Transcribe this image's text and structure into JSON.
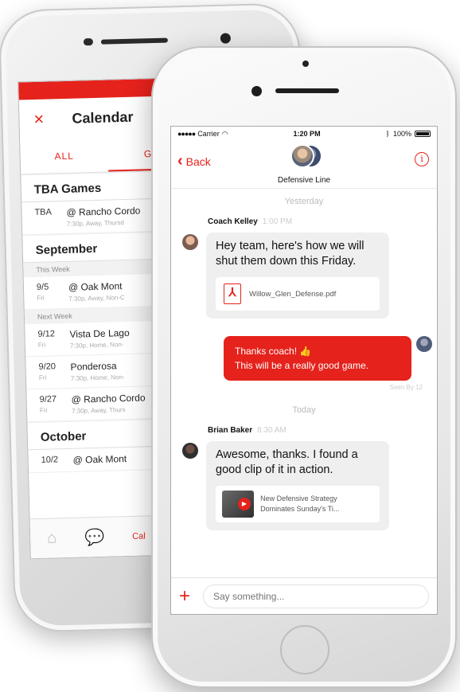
{
  "calendar_screen": {
    "title": "Calendar",
    "close_icon": "×",
    "tabs": [
      {
        "label": "ALL",
        "active": false
      },
      {
        "label": "GA",
        "active": true
      }
    ],
    "sections": [
      {
        "heading": "TBA Games",
        "rows": [
          {
            "date": "TBA",
            "day": "",
            "event": "@ Rancho Cordo",
            "detail": "7:30p, Away, Thursd"
          }
        ]
      },
      {
        "heading": "September",
        "groups": [
          {
            "label": "This Week",
            "rows": [
              {
                "date": "9/5",
                "day": "Fri",
                "event": "@ Oak Mont",
                "detail": "7:30p, Away, Non-C"
              }
            ]
          },
          {
            "label": "Next Week",
            "rows": [
              {
                "date": "9/12",
                "day": "Fri",
                "event": "Vista De Lago",
                "detail": "7:30p, Home, Non-"
              },
              {
                "date": "9/20",
                "day": "Fri",
                "event": "Ponderosa",
                "detail": "7:30p, Home, Non-"
              },
              {
                "date": "9/27",
                "day": "Fri",
                "event": "@ Rancho Cordo",
                "detail": "7:30p, Away, Thurs"
              }
            ]
          }
        ]
      },
      {
        "heading": "October",
        "rows": [
          {
            "date": "10/2",
            "day": "",
            "event": "@ Oak Mont",
            "detail": ""
          }
        ]
      }
    ],
    "tabbar": {
      "calendar_label": "Cal"
    }
  },
  "chat_screen": {
    "status_bar": {
      "carrier": "Carrier",
      "time": "1:20 PM",
      "battery": "100%"
    },
    "nav": {
      "back_label": "Back",
      "group_name": "Defensive Line",
      "info_icon": "i"
    },
    "days": [
      {
        "label": "Yesterday",
        "messages": [
          {
            "sender": "Coach Kelley",
            "time": "1:00 PM",
            "text": "Hey team, here's how we will shut them down this Friday.",
            "attachment": "Willow_Glen_Defense.pdf"
          },
          {
            "outgoing": true,
            "text_line1": "Thanks coach! 👍",
            "text_line2": "This will be a really good game.",
            "status": "Seen By 12"
          }
        ]
      },
      {
        "label": "Today",
        "messages": [
          {
            "sender": "Brian Baker",
            "time": "8:30 AM",
            "text": "Awesome, thanks. I found a good clip of it in action.",
            "link_title": "New Defensive Strategy Dominates Sunday's Ti..."
          }
        ]
      }
    ],
    "composer": {
      "placeholder": "Say something...",
      "add_icon": "+"
    }
  }
}
